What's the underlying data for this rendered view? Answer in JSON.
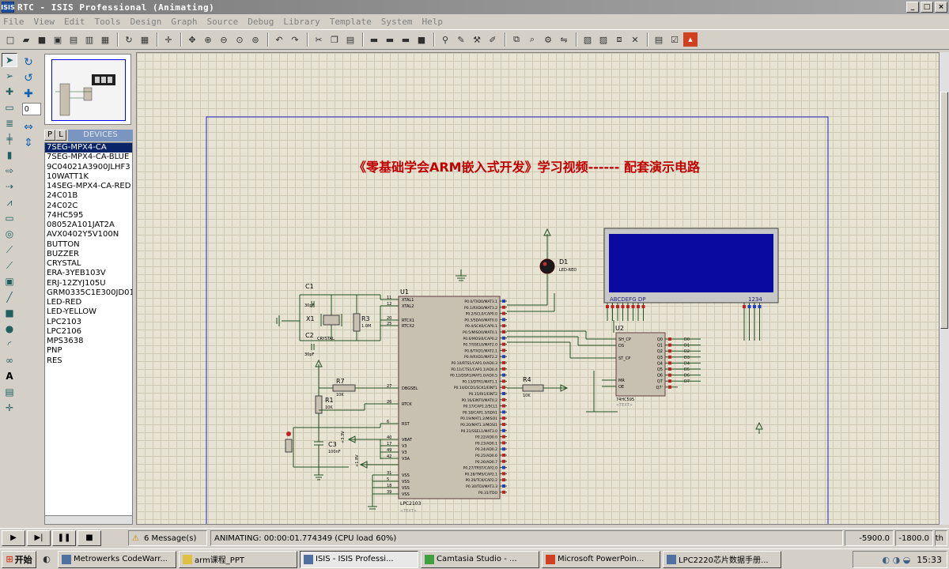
{
  "window": {
    "title": "RTC - ISIS Professional (Animating)",
    "logo": "ISIS",
    "buttons": [
      "_",
      "□",
      "×"
    ]
  },
  "menu": [
    "File",
    "View",
    "Edit",
    "Tools",
    "Design",
    "Graph",
    "Source",
    "Debug",
    "Library",
    "Template",
    "System",
    "Help"
  ],
  "rotation": {
    "angle": "0"
  },
  "devices": {
    "header": "DEVICES",
    "tab_p": "P",
    "tab_l": "L",
    "items": [
      "7SEG-MPX4-CA",
      "7SEG-MPX4-CA-BLUE",
      "9C04021A3900JLHF3",
      "10WATT1K",
      "14SEG-MPX4-CA-RED",
      "24C01B",
      "24C02C",
      "74HC595",
      "08052A101JAT2A",
      "AVX0402Y5V100N",
      "BUTTON",
      "BUZZER",
      "CRYSTAL",
      "ERA-3YEB103V",
      "ERJ-12ZYJ105U",
      "GRM0335C1E300JD01D",
      "LED-RED",
      "LED-YELLOW",
      "LPC2103",
      "LPC2106",
      "MPS3638",
      "PNP",
      "RES"
    ],
    "selected_index": 0
  },
  "schematic": {
    "banner": "《零基础学会ARM嵌入式开发》学习视频------ 配套演示电路",
    "u1_label": "U1",
    "u1_part": "LPC2103",
    "u1_left_pins": [
      "XTAL1",
      "XTAL2",
      "RTCX1",
      "RTCX2",
      "DBGSEL",
      "RTCK",
      "RST",
      "VBAT",
      "V3",
      "V3",
      "V3A",
      "VSS",
      "VSS",
      "VSS",
      "VSS"
    ],
    "u1_right_pins": [
      "P0.0/TXD0/MAT3.1",
      "P0.1/RXD0/MAT3.2",
      "P0.2/SCL0/CAP0.0",
      "P0.3/SDA0/MAT0.0",
      "P0.4/SCK0/CAP0.1",
      "P0.5/MISO0/MAT0.1",
      "P0.6/MOSI0/CAP0.2",
      "P0.7/SSEL0/MAT2.0",
      "P0.8/TXD1/MAT2.1",
      "P0.9/RXD1/MAT2.2",
      "P0.10/RTS1/CAP1.0/AD0.3",
      "P0.11/CTS1/CAP1.1/AD0.4",
      "P0.12/DSR1/MAT1.0/AD0.5",
      "P0.13/DTR1/MAT1.1",
      "P0.14/DCD1/SCK1/EINT1",
      "P0.15/RI1/EINT2",
      "P0.16/EINT0/MAT0.2",
      "P0.17/CAP1.2/SCL1",
      "P0.18/CAP1.3/SDA1",
      "P0.19/MAT1.2/MISO1",
      "P0.20/MAT1.3/MOSI1",
      "P0.21/SSEL1/MAT3.0",
      "P0.22/AD0.0",
      "P0.23/AD0.1",
      "P0.24/AD0.2",
      "P0.25/AD0.6",
      "P0.26/AD0.7",
      "P0.27/TRST/CAP2.0",
      "P0.28/TMS/CAP2.1",
      "P0.29/TCK/CAP2.2",
      "P0.30/TDI/MAT3.3",
      "P0.31/TDO"
    ],
    "u2_label": "U2",
    "u2_part": "74HC595",
    "u2_left_pins": [
      "SH_CP",
      "DS",
      "ST_CP",
      "MR",
      "OE"
    ],
    "u2_right_pins": [
      "Q0",
      "Q1",
      "Q2",
      "Q3",
      "Q4",
      "Q5",
      "Q6",
      "Q7",
      "Q7'"
    ],
    "u2_q_labels": [
      "D0",
      "D1",
      "D2",
      "D3",
      "D4",
      "D5",
      "D6",
      "D7"
    ],
    "d1_label": "D1",
    "d1_part": "LED-RED",
    "x1_label": "X1",
    "x1_part": "CRYSTAL",
    "c1_label": "C1",
    "c1_value": "30pF",
    "c2_label": "C2",
    "c2_value": "30pF",
    "c3_label": "C3",
    "c3_value": "100nF",
    "r1_label": "R1",
    "r1_value": "10K",
    "r3_label": "R3",
    "r3_value": "1.0M",
    "r4_label": "R4",
    "r4_value": "10K",
    "r7_label": "R7",
    "r7_value": "10K",
    "text_tag": "<TEXT>",
    "lcd_seg_labels": "ABCDEFG  DP",
    "lcd_digit_labels": "1234",
    "supply_33v": "+3.3V",
    "supply_18v": "+1.8V",
    "pin_numbers_u1_left": [
      "11",
      "12",
      "20",
      "25",
      "27",
      "26",
      "6",
      "40",
      "17",
      "49",
      "42",
      "31",
      "5",
      "18",
      "39"
    ]
  },
  "status": {
    "messages": "6 Message(s)",
    "animating": "ANIMATING: 00:00:01.774349 (CPU load 60%)",
    "x": "-5900.0",
    "y": "-1800.0",
    "unit": "th"
  },
  "taskbar": {
    "start": "开始",
    "tasks": [
      {
        "label": "Metrowerks CodeWarr..."
      },
      {
        "label": "arm课程_PPT"
      },
      {
        "label": "ISIS - ISIS Professi..."
      },
      {
        "label": "Camtasia Studio - ..."
      },
      {
        "label": "Microsoft PowerPoin..."
      },
      {
        "label": "LPC2220芯片数据手册..."
      }
    ],
    "active_task": 2,
    "time": "15:33"
  },
  "colors": {
    "lcd_blue": "#0a0aa0",
    "chip_fill": "#c8c0b0",
    "wire": "#205020",
    "banner_red": "#c00000"
  }
}
